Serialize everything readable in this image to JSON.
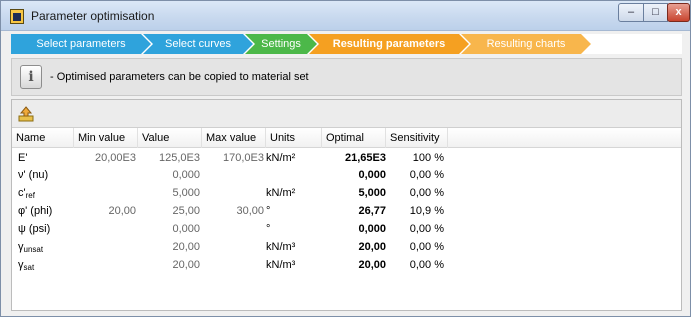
{
  "window": {
    "title": "Parameter optimisation"
  },
  "wizard": {
    "steps": [
      {
        "label": "Select parameters",
        "state": "done"
      },
      {
        "label": "Select curves",
        "state": "done"
      },
      {
        "label": "Settings",
        "state": "done-green"
      },
      {
        "label": "Resulting parameters",
        "state": "active"
      },
      {
        "label": "Resulting charts",
        "state": "todo"
      }
    ]
  },
  "info": {
    "text": "- Optimised parameters can be copied to material set",
    "icon": "info-icon"
  },
  "toolbar": {
    "copy_icon": "copy-to-material-icon"
  },
  "table": {
    "columns": [
      "Name",
      "Min value",
      "Value",
      "Max value",
      "Units",
      "Optimal",
      "Sensitivity"
    ],
    "rows": [
      {
        "name": "E'",
        "name_sub": "",
        "min": "20,00E3",
        "value": "125,0E3",
        "max": "170,0E3",
        "units": "kN/m²",
        "optimal": "21,65E3",
        "sensitivity": "100 %"
      },
      {
        "name": "ν' (nu)",
        "name_sub": "",
        "min": "",
        "value": "0,000",
        "max": "",
        "units": "",
        "optimal": "0,000",
        "sensitivity": "0,00 %"
      },
      {
        "name": "c'",
        "name_sub": "ref",
        "min": "",
        "value": "5,000",
        "max": "",
        "units": "kN/m²",
        "optimal": "5,000",
        "sensitivity": "0,00 %"
      },
      {
        "name": "φ' (phi)",
        "name_sub": "",
        "min": "20,00",
        "value": "25,00",
        "max": "30,00",
        "units": "°",
        "optimal": "26,77",
        "sensitivity": "10,9 %"
      },
      {
        "name": "ψ (psi)",
        "name_sub": "",
        "min": "",
        "value": "0,000",
        "max": "",
        "units": "°",
        "optimal": "0,000",
        "sensitivity": "0,00 %"
      },
      {
        "name": "γ",
        "name_sub": "unsat",
        "min": "",
        "value": "20,00",
        "max": "",
        "units": "kN/m³",
        "optimal": "20,00",
        "sensitivity": "0,00 %"
      },
      {
        "name": "γ",
        "name_sub": "sat",
        "min": "",
        "value": "20,00",
        "max": "",
        "units": "kN/m³",
        "optimal": "20,00",
        "sensitivity": "0,00 %"
      }
    ]
  },
  "colors": {
    "step_done": "#2fa3dc",
    "step_green": "#4cb849",
    "step_active": "#f5a021",
    "step_todo": "#f8b64c"
  }
}
